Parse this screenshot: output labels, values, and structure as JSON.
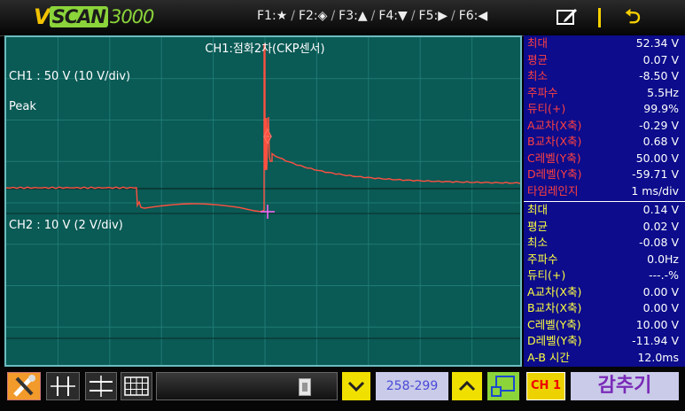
{
  "app": {
    "logo_v": "V",
    "logo_scan": "SCAN",
    "logo_num": "3000"
  },
  "toolbar": {
    "fkeys": [
      {
        "key": "F1:",
        "icon": "star-icon",
        "glyph": "★"
      },
      {
        "key": "F2:",
        "icon": "diamond-icon",
        "glyph": "◈"
      },
      {
        "key": "F3:",
        "icon": "triangle-up-icon",
        "glyph": "▲"
      },
      {
        "key": "F4:",
        "icon": "triangle-down-icon",
        "glyph": "▼"
      },
      {
        "key": "F5:",
        "icon": "triangle-right-icon",
        "glyph": "▶"
      },
      {
        "key": "F6:",
        "icon": "triangle-left-icon",
        "glyph": "◀"
      }
    ],
    "sep": "/",
    "edit_icon": "edit-icon",
    "back_icon": "back-icon",
    "back_glyph": "⮌"
  },
  "scope": {
    "title": "CH1:점화2차(CKP센서)",
    "ch1_scale": "CH1 : 50 V (10 V/div)",
    "peak_label": "Peak",
    "ch2_scale": "CH2 : 10 V (2 V/div)",
    "ch1_color": "#ff5040",
    "ch2_color": "#000000",
    "cursor_marker_color": "#ff66ff",
    "grid_color": "#1f7a75"
  },
  "measurements": {
    "ch1": [
      {
        "label": "최대",
        "value": "52.34 V"
      },
      {
        "label": "평균",
        "value": "0.07 V"
      },
      {
        "label": "최소",
        "value": "-8.50 V"
      },
      {
        "label": "주파수",
        "value": "5.5Hz"
      },
      {
        "label": "듀티(+)",
        "value": "99.9%"
      },
      {
        "label": "A교차(X축)",
        "value": "-0.29 V"
      },
      {
        "label": "B교차(X축)",
        "value": "0.68 V"
      },
      {
        "label": "C레벨(Y축)",
        "value": "50.00 V"
      },
      {
        "label": "D레벨(Y축)",
        "value": "-59.71 V"
      },
      {
        "label": "타임레인지",
        "value": "1 ms/div"
      }
    ],
    "ch2": [
      {
        "label": "최대",
        "value": "0.14 V"
      },
      {
        "label": "평균",
        "value": "0.02 V"
      },
      {
        "label": "최소",
        "value": "-0.08 V"
      },
      {
        "label": "주파수",
        "value": "0.0Hz"
      },
      {
        "label": "듀티(+)",
        "value": "---.-%"
      },
      {
        "label": "A교차(X축)",
        "value": "0.00 V"
      },
      {
        "label": "B교차(X축)",
        "value": "0.00 V"
      },
      {
        "label": "C레벨(Y축)",
        "value": "10.00 V"
      },
      {
        "label": "D레벨(Y축)",
        "value": "-11.94 V"
      },
      {
        "label": "A-B 시간",
        "value": "12.0ms"
      }
    ],
    "ch1_label_color": "#ff4040",
    "ch2_label_color": "#ffff40"
  },
  "bottom": {
    "tool_icons": [
      "tools-icon",
      "cursor-ab-icon",
      "cursor-cd-icon",
      "grid-icon"
    ],
    "slider_icon": "slider-thumb-icon",
    "down_icon": "chevron-down-icon",
    "range": "258-299",
    "up_icon": "chevron-up-icon",
    "cursor_icon": "cursor-select-icon",
    "ch_label": "CH 1",
    "hold_label": "감추기"
  }
}
